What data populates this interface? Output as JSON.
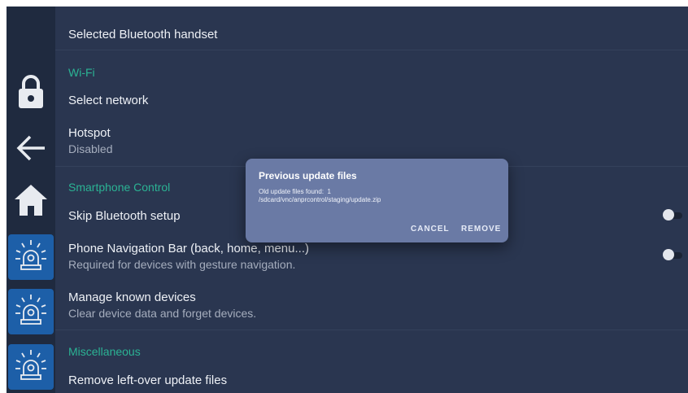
{
  "sidebar": {
    "icons": [
      "lock-icon",
      "back-arrow-icon",
      "home-icon",
      "siren-icon",
      "siren-icon",
      "siren-icon"
    ]
  },
  "settings": {
    "bluetooth_item": "Selected Bluetooth handset",
    "wifi_section": "Wi-Fi",
    "select_network": "Select network",
    "hotspot_title": "Hotspot",
    "hotspot_status": "Disabled",
    "smartphone_section": "Smartphone Control",
    "skip_bluetooth": "Skip Bluetooth setup",
    "nav_bar_title": "Phone Navigation Bar (back, home, menu...)",
    "nav_bar_sub": "Required for devices with gesture navigation.",
    "manage_devices_title": "Manage known devices",
    "manage_devices_sub": "Clear device data and forget devices.",
    "misc_section": "Miscellaneous",
    "remove_files": "Remove left-over update files"
  },
  "dialog": {
    "title": "Previous update files",
    "message": "Old update files found:  1\n/sdcard/vnc/anprcontrol/staging/update.zip",
    "cancel": "CANCEL",
    "remove": "REMOVE"
  },
  "colors": {
    "background": "#2a3650",
    "sidebar": "#1f2a3f",
    "accent": "#2bb394",
    "alarm_button": "#1d5fa8",
    "dialog": "#6a7aa5"
  }
}
